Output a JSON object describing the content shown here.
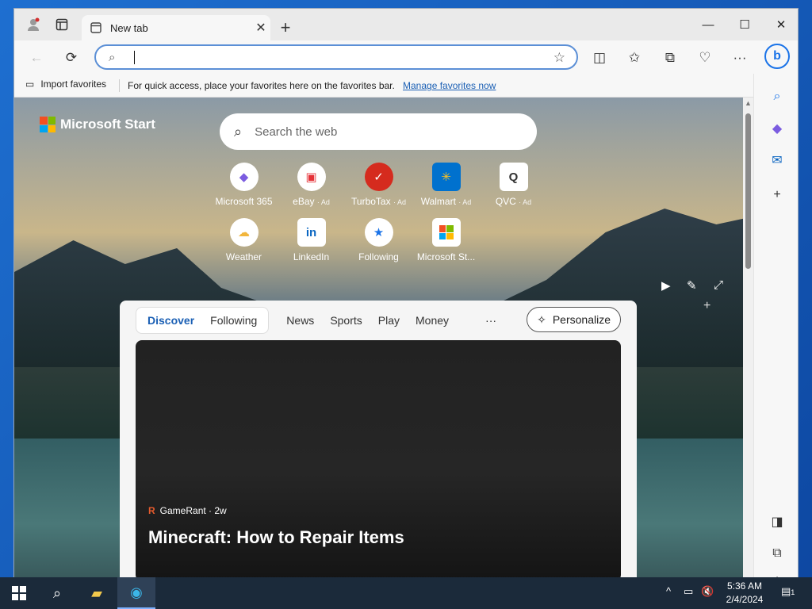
{
  "browser": {
    "tab_title": "New tab",
    "address_value": "",
    "favorites_bar": {
      "import_label": "Import favorites",
      "message": "For quick access, place your favorites here on the favorites bar.",
      "manage_link": "Manage favorites now"
    }
  },
  "newtab": {
    "brand": "Microsoft Start",
    "search_placeholder": "Search the web",
    "quick_links": [
      {
        "label": "Microsoft 365",
        "ad": "",
        "icon": "microsoft365-icon"
      },
      {
        "label": "eBay",
        "ad": "· Ad",
        "icon": "ebay-icon"
      },
      {
        "label": "TurboTax",
        "ad": "· Ad",
        "icon": "turbotax-icon"
      },
      {
        "label": "Walmart",
        "ad": "· Ad",
        "icon": "walmart-icon"
      },
      {
        "label": "QVC",
        "ad": "· Ad",
        "icon": "qvc-icon"
      },
      {
        "label": "Weather",
        "ad": "",
        "icon": "weather-icon"
      },
      {
        "label": "LinkedIn",
        "ad": "",
        "icon": "linkedin-icon"
      },
      {
        "label": "Following",
        "ad": "",
        "icon": "following-icon"
      },
      {
        "label": "Microsoft St...",
        "ad": "",
        "icon": "microsoft-store-icon"
      }
    ],
    "feed_tabs": [
      "Discover",
      "Following",
      "News",
      "Sports",
      "Play",
      "Money"
    ],
    "more_label": "···",
    "personalize_label": "Personalize",
    "card": {
      "source": "GameRant · 2w",
      "headline": "Minecraft: How to Repair Items"
    }
  },
  "taskbar": {
    "time": "5:36 AM",
    "date": "2/4/2024",
    "notification_count": "1"
  },
  "colors": {
    "accent": "#1a5fb4",
    "ms_red": "#f25022",
    "ms_green": "#7fba00",
    "ms_blue": "#00a4ef",
    "ms_yellow": "#ffb900"
  }
}
